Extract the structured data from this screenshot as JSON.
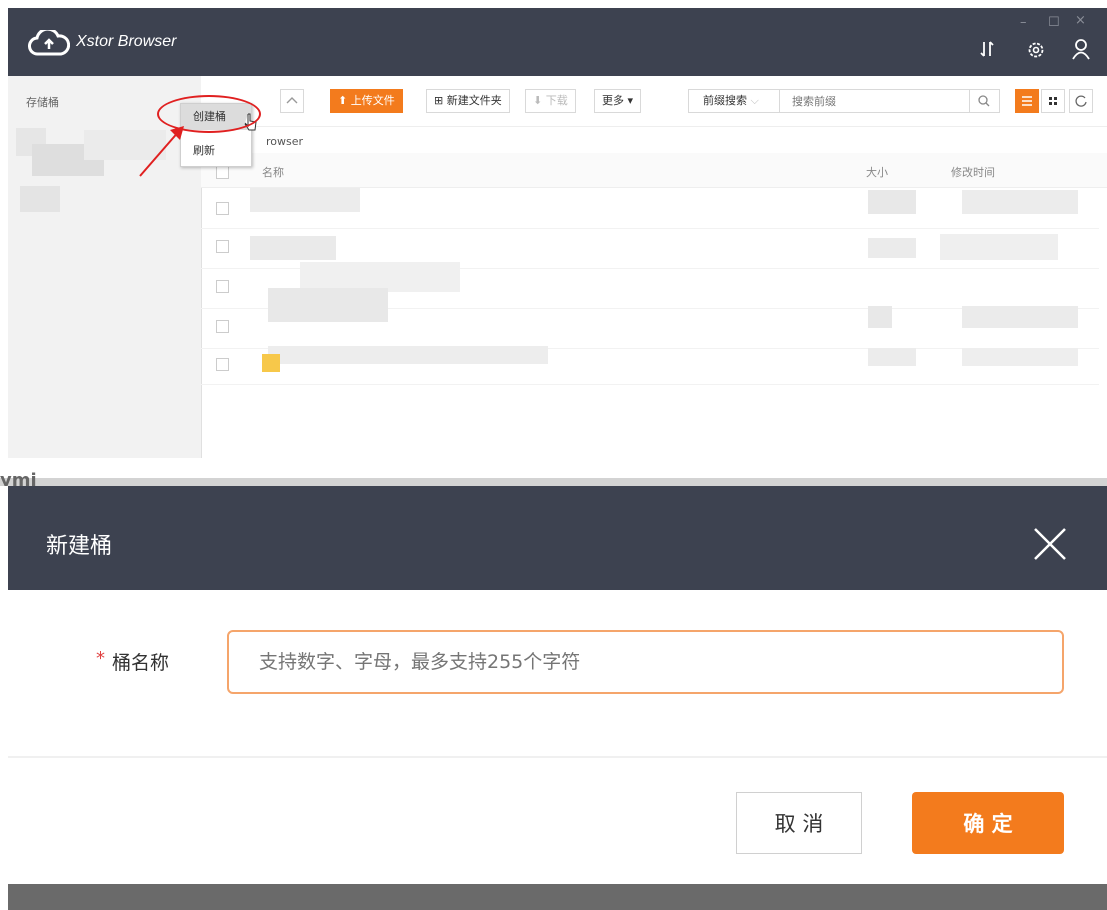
{
  "app": {
    "title": "Xstor Browser",
    "window_controls": [
      "–",
      "☐",
      "×"
    ],
    "toolbar_icons": [
      "transfer-icon",
      "settings-icon",
      "user-icon"
    ]
  },
  "sidebar": {
    "label": "存储桶"
  },
  "toolbar": {
    "upload": "上传文件",
    "new_folder": "新建文件夹",
    "download": "下载",
    "more": "更多",
    "prefix_select": "前缀搜索",
    "prefix_placeholder": "搜索前缀"
  },
  "context_menu": {
    "items": [
      "创建桶",
      "刷新"
    ]
  },
  "breadcrumb": "rowser",
  "table": {
    "columns": [
      "名称",
      "大小",
      "修改时间"
    ]
  },
  "separator_text": "ymi",
  "dialog": {
    "title": "新建桶",
    "required_mark": "*",
    "field_label": "桶名称",
    "placeholder": "支持数字、字母，最多支持255个字符",
    "cancel": "取 消",
    "confirm": "确 定"
  },
  "colors": {
    "accent": "#f37b1d",
    "header": "#3d4250",
    "annotation": "#e02020"
  }
}
